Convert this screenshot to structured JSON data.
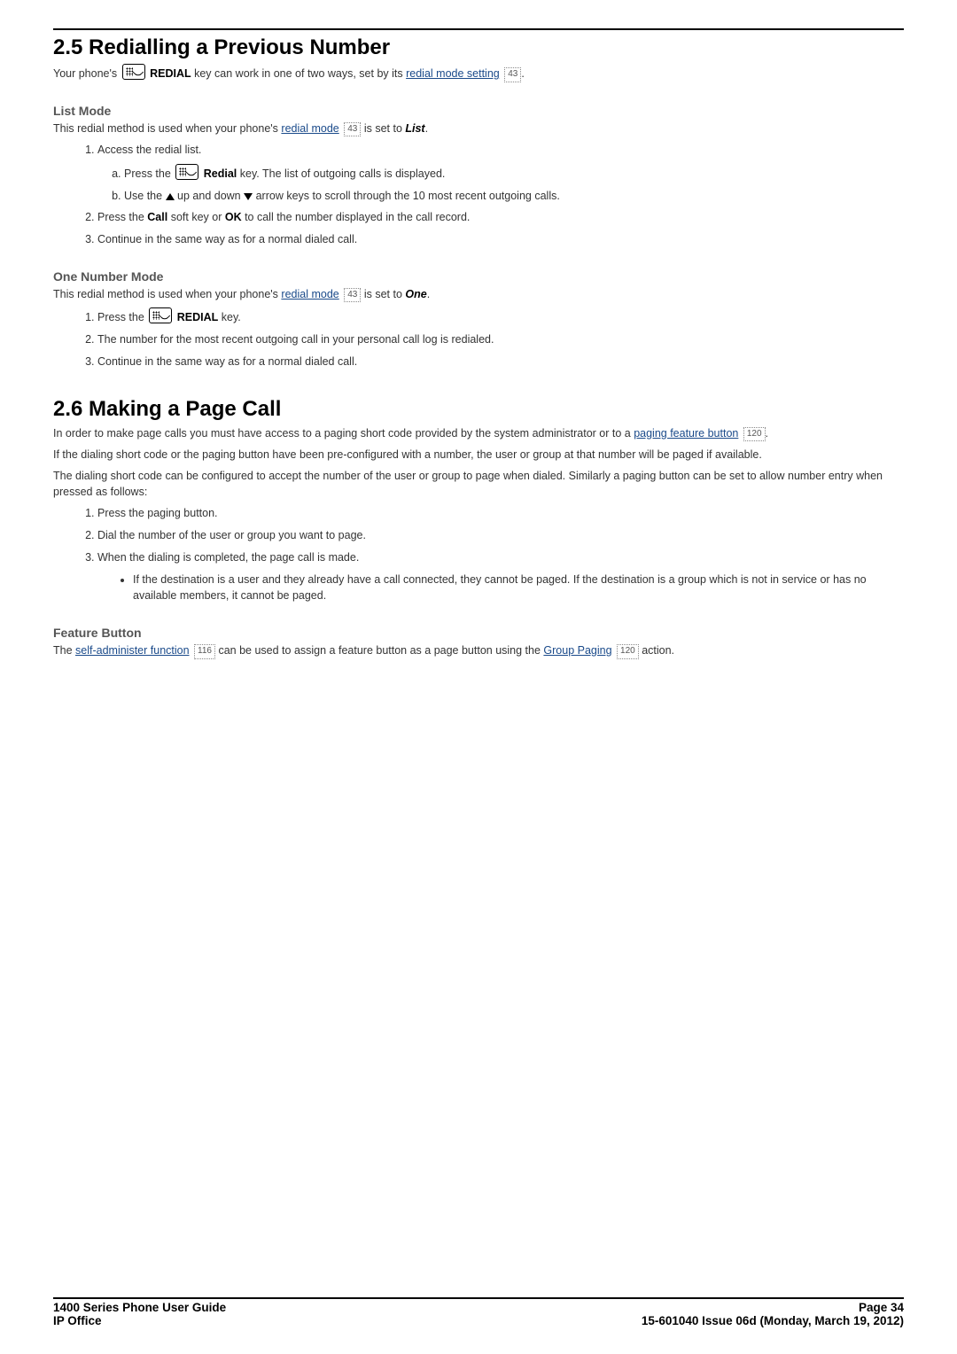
{
  "section25": {
    "heading": "2.5 Redialling a Previous Number",
    "intro_a": "Your phone's ",
    "intro_b": "REDIAL",
    "intro_c": " key can work in one of two ways, set by its ",
    "intro_link": "redial mode setting",
    "intro_ref": "43",
    "intro_d": ".",
    "list_mode": {
      "title": "List Mode",
      "desc_a": "This redial method is used when your phone's ",
      "desc_link": "redial mode",
      "desc_ref": "43",
      "desc_b": " is set to ",
      "desc_val": "List",
      "desc_c": ".",
      "step1": "Access the redial list.",
      "step1a_a": "Press the ",
      "step1a_key": "Redial",
      "step1a_b": " key. The list of outgoing calls is displayed.",
      "step1b_a": "Use the ",
      "step1b_b": " up and down ",
      "step1b_c": " arrow keys to scroll through the 10 most recent outgoing calls.",
      "step2_a": "Press the ",
      "step2_k1": "Call",
      "step2_b": " soft key or ",
      "step2_k2": "OK",
      "step2_c": " to call the number displayed in the call record.",
      "step3": "Continue in the same way as for a normal dialed call."
    },
    "one_mode": {
      "title": "One Number Mode",
      "desc_a": "This redial method is used when your phone's ",
      "desc_link": "redial mode",
      "desc_ref": "43",
      "desc_b": " is set to ",
      "desc_val": "One",
      "desc_c": ".",
      "step1_a": "Press the ",
      "step1_key": "REDIAL",
      "step1_b": " key.",
      "step2": "The number for the most recent outgoing call in your personal call log is redialed.",
      "step3": "Continue in the same way as for a normal dialed call."
    }
  },
  "section26": {
    "heading": "2.6 Making a Page Call",
    "p1_a": "In order to make page calls you must have access to a paging short code provided by the system administrator or to a ",
    "p1_link": "paging feature button",
    "p1_ref": "120",
    "p1_b": ".",
    "p2": "If the dialing short code or the paging button have been pre-configured with a number, the user or group at that number will be paged if available.",
    "p3": "The dialing short code can be configured to accept the number of the user or group to page when dialed. Similarly a paging button can be set to allow number entry when pressed as follows:",
    "step1": "Press the paging button.",
    "step2": "Dial the number of the user or group you want to page.",
    "step3": "When the dialing is completed, the page call is made.",
    "bullet": "If the destination is a user and they already have a call connected, they cannot be paged. If the destination is a group which is not in service or has no available members, it cannot be paged.",
    "fb_title": "Feature Button",
    "fb_a": "The ",
    "fb_link1": "self-administer function",
    "fb_ref1": "116",
    "fb_b": " can be used to assign a feature button as a page button using the ",
    "fb_link2": "Group Paging",
    "fb_ref2": "120",
    "fb_c": " action."
  },
  "footer": {
    "left1": "1400 Series Phone User Guide",
    "left2": "IP Office",
    "right1": "Page 34",
    "right2": "15-601040 Issue 06d (Monday, March 19, 2012)"
  }
}
